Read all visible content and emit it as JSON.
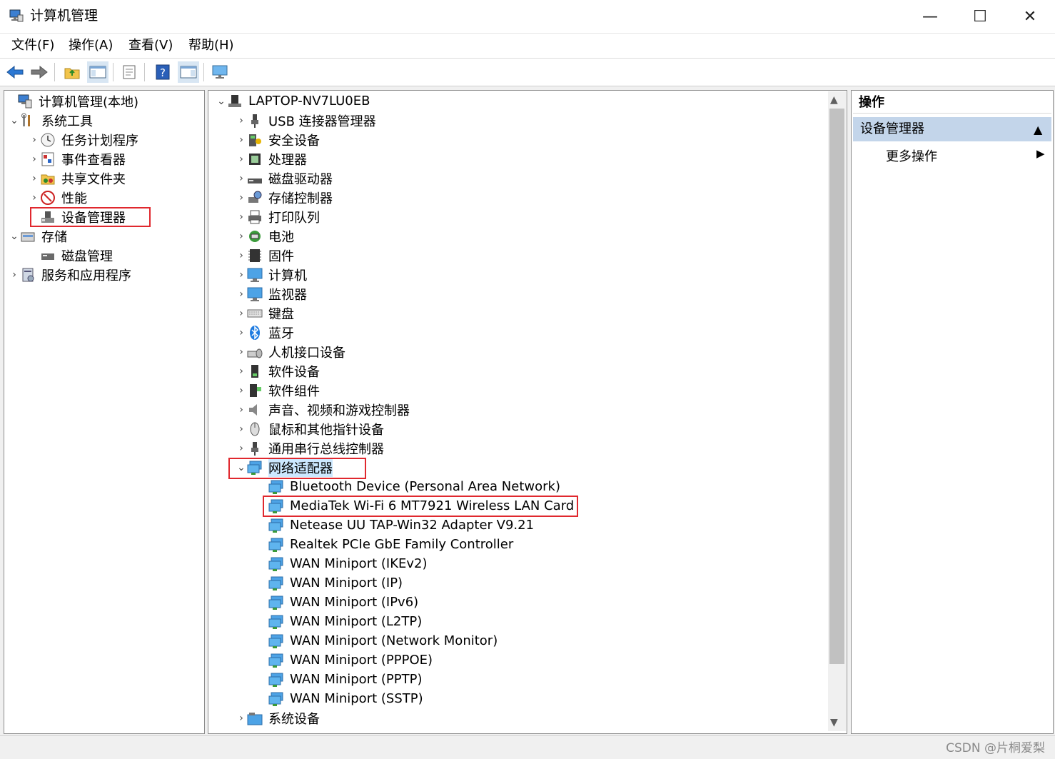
{
  "window": {
    "title": "计算机管理",
    "controls": {
      "minimize": "—",
      "maximize": "☐",
      "close": "✕"
    }
  },
  "menu": [
    "文件(F)",
    "操作(A)",
    "查看(V)",
    "帮助(H)"
  ],
  "left_tree": [
    {
      "label": "计算机管理(本地)",
      "icon": "computer-management-icon",
      "chevron": ""
    },
    {
      "label": "系统工具",
      "icon": "system-tools-icon",
      "chevron": "⌄"
    },
    {
      "label": "任务计划程序",
      "icon": "task-scheduler-icon",
      "chevron": "›"
    },
    {
      "label": "事件查看器",
      "icon": "event-viewer-icon",
      "chevron": "›"
    },
    {
      "label": "共享文件夹",
      "icon": "shared-folders-icon",
      "chevron": "›"
    },
    {
      "label": "性能",
      "icon": "performance-icon",
      "chevron": "›"
    },
    {
      "label": "设备管理器",
      "icon": "device-manager-icon",
      "chevron": "",
      "selected": true
    },
    {
      "label": "存储",
      "icon": "storage-icon",
      "chevron": "⌄"
    },
    {
      "label": "磁盘管理",
      "icon": "disk-management-icon",
      "chevron": ""
    },
    {
      "label": "服务和应用程序",
      "icon": "services-apps-icon",
      "chevron": "›"
    }
  ],
  "device_tree": {
    "root": "LAPTOP-NV7LU0EB",
    "categories": [
      {
        "label": "USB 连接器管理器",
        "icon": "usb-icon"
      },
      {
        "label": "安全设备",
        "icon": "security-device-icon"
      },
      {
        "label": "处理器",
        "icon": "processor-icon"
      },
      {
        "label": "磁盘驱动器",
        "icon": "disk-drive-icon"
      },
      {
        "label": "存储控制器",
        "icon": "storage-controller-icon"
      },
      {
        "label": "打印队列",
        "icon": "printer-icon"
      },
      {
        "label": "电池",
        "icon": "battery-icon"
      },
      {
        "label": "固件",
        "icon": "firmware-icon"
      },
      {
        "label": "计算机",
        "icon": "computer-icon"
      },
      {
        "label": "监视器",
        "icon": "monitor-icon"
      },
      {
        "label": "键盘",
        "icon": "keyboard-icon"
      },
      {
        "label": "蓝牙",
        "icon": "bluetooth-icon"
      },
      {
        "label": "人机接口设备",
        "icon": "hid-icon"
      },
      {
        "label": "软件设备",
        "icon": "software-device-icon"
      },
      {
        "label": "软件组件",
        "icon": "software-component-icon"
      },
      {
        "label": "声音、视频和游戏控制器",
        "icon": "sound-icon"
      },
      {
        "label": "鼠标和其他指针设备",
        "icon": "mouse-icon"
      },
      {
        "label": "通用串行总线控制器",
        "icon": "usb-controller-icon"
      }
    ],
    "network_adapters": {
      "label": "网络适配器",
      "children": [
        "Bluetooth Device (Personal Area Network)",
        "MediaTek Wi-Fi 6 MT7921 Wireless LAN Card",
        "Netease UU TAP-Win32 Adapter V9.21",
        "Realtek PCIe GbE Family Controller",
        "WAN Miniport (IKEv2)",
        "WAN Miniport (IP)",
        "WAN Miniport (IPv6)",
        "WAN Miniport (L2TP)",
        "WAN Miniport (Network Monitor)",
        "WAN Miniport (PPPOE)",
        "WAN Miniport (PPTP)",
        "WAN Miniport (SSTP)"
      ]
    },
    "after": [
      {
        "label": "系统设备",
        "icon": "system-device-icon"
      }
    ]
  },
  "actions_panel": {
    "header": "操作",
    "section": "设备管理器",
    "more": "更多操作"
  },
  "watermark": "CSDN @片桐爱梨",
  "colors": {
    "highlight_box": "#e0282e",
    "selection": "#cce8ff",
    "actions_section": "#c3d5ea"
  }
}
